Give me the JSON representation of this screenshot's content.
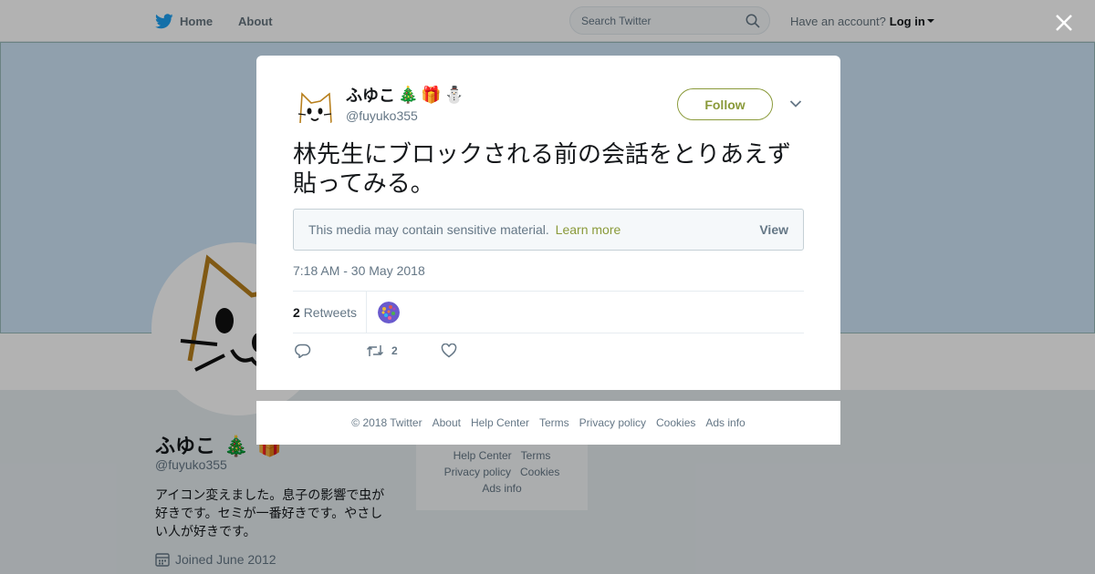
{
  "topbar": {
    "home_label": "Home",
    "about_label": "About",
    "search_placeholder": "Search Twitter",
    "account_prompt": "Have an account?",
    "login_label": "Log in"
  },
  "profile": {
    "name": "ふゆこ",
    "handle": "@fuyuko355",
    "bio": "アイコン変えました。息子の影響で虫が好きです。セミが一番好きです。やさしい人が好きです。",
    "joined": "Joined June 2012"
  },
  "side_footer": {
    "help_center": "Help Center",
    "terms": "Terms",
    "privacy_policy": "Privacy policy",
    "cookies": "Cookies",
    "ads_info": "Ads info"
  },
  "tweet": {
    "name": "ふゆこ",
    "name_emojis": [
      "🎄",
      "🎁",
      "⛄"
    ],
    "handle": "@fuyuko355",
    "follow_label": "Follow",
    "text": "林先生にブロックされる前の会話をとりあえず貼ってみる。",
    "sensitive_message": "This media may contain sensitive material.",
    "learn_more": "Learn more",
    "view_label": "View",
    "timestamp": "7:18 AM - 30 May 2018",
    "retweet_count": "2",
    "retweets_label": "Retweets",
    "action_retweet_count": "2"
  },
  "modal_footer": {
    "copyright": "© 2018 Twitter",
    "about": "About",
    "help_center": "Help Center",
    "terms": "Terms",
    "privacy_policy": "Privacy policy",
    "cookies": "Cookies",
    "ads_info": "Ads info"
  },
  "colors": {
    "accent": "#8a9a3a",
    "twitter_blue": "#1da1f2",
    "muted_text": "#657786"
  },
  "icons": [
    "twitter-bird-icon",
    "search-icon",
    "close-icon",
    "chevron-down-icon",
    "reply-icon",
    "retweet-icon",
    "heart-icon",
    "calendar-icon"
  ]
}
